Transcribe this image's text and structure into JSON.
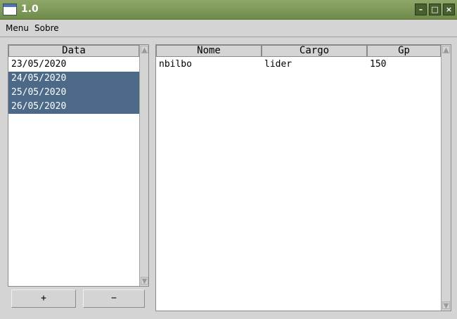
{
  "window": {
    "title": "1.0",
    "minimize": "–",
    "maximize": "□",
    "close": "×"
  },
  "menubar": {
    "menu": "Menu",
    "sobre": "Sobre"
  },
  "dates_table": {
    "header": "Data",
    "rows": [
      "23/05/2020",
      "24/05/2020",
      "25/05/2020",
      "26/05/2020"
    ]
  },
  "members_table": {
    "headers": {
      "nome": "Nome",
      "cargo": "Cargo",
      "gp": "Gp"
    },
    "rows": [
      {
        "nome": "nbilbo",
        "cargo": "lider",
        "gp": "150"
      }
    ]
  },
  "buttons": {
    "add": "+",
    "remove": "−"
  },
  "colors": {
    "selection": "#4c6a88",
    "titlebar": "#7a9656"
  }
}
